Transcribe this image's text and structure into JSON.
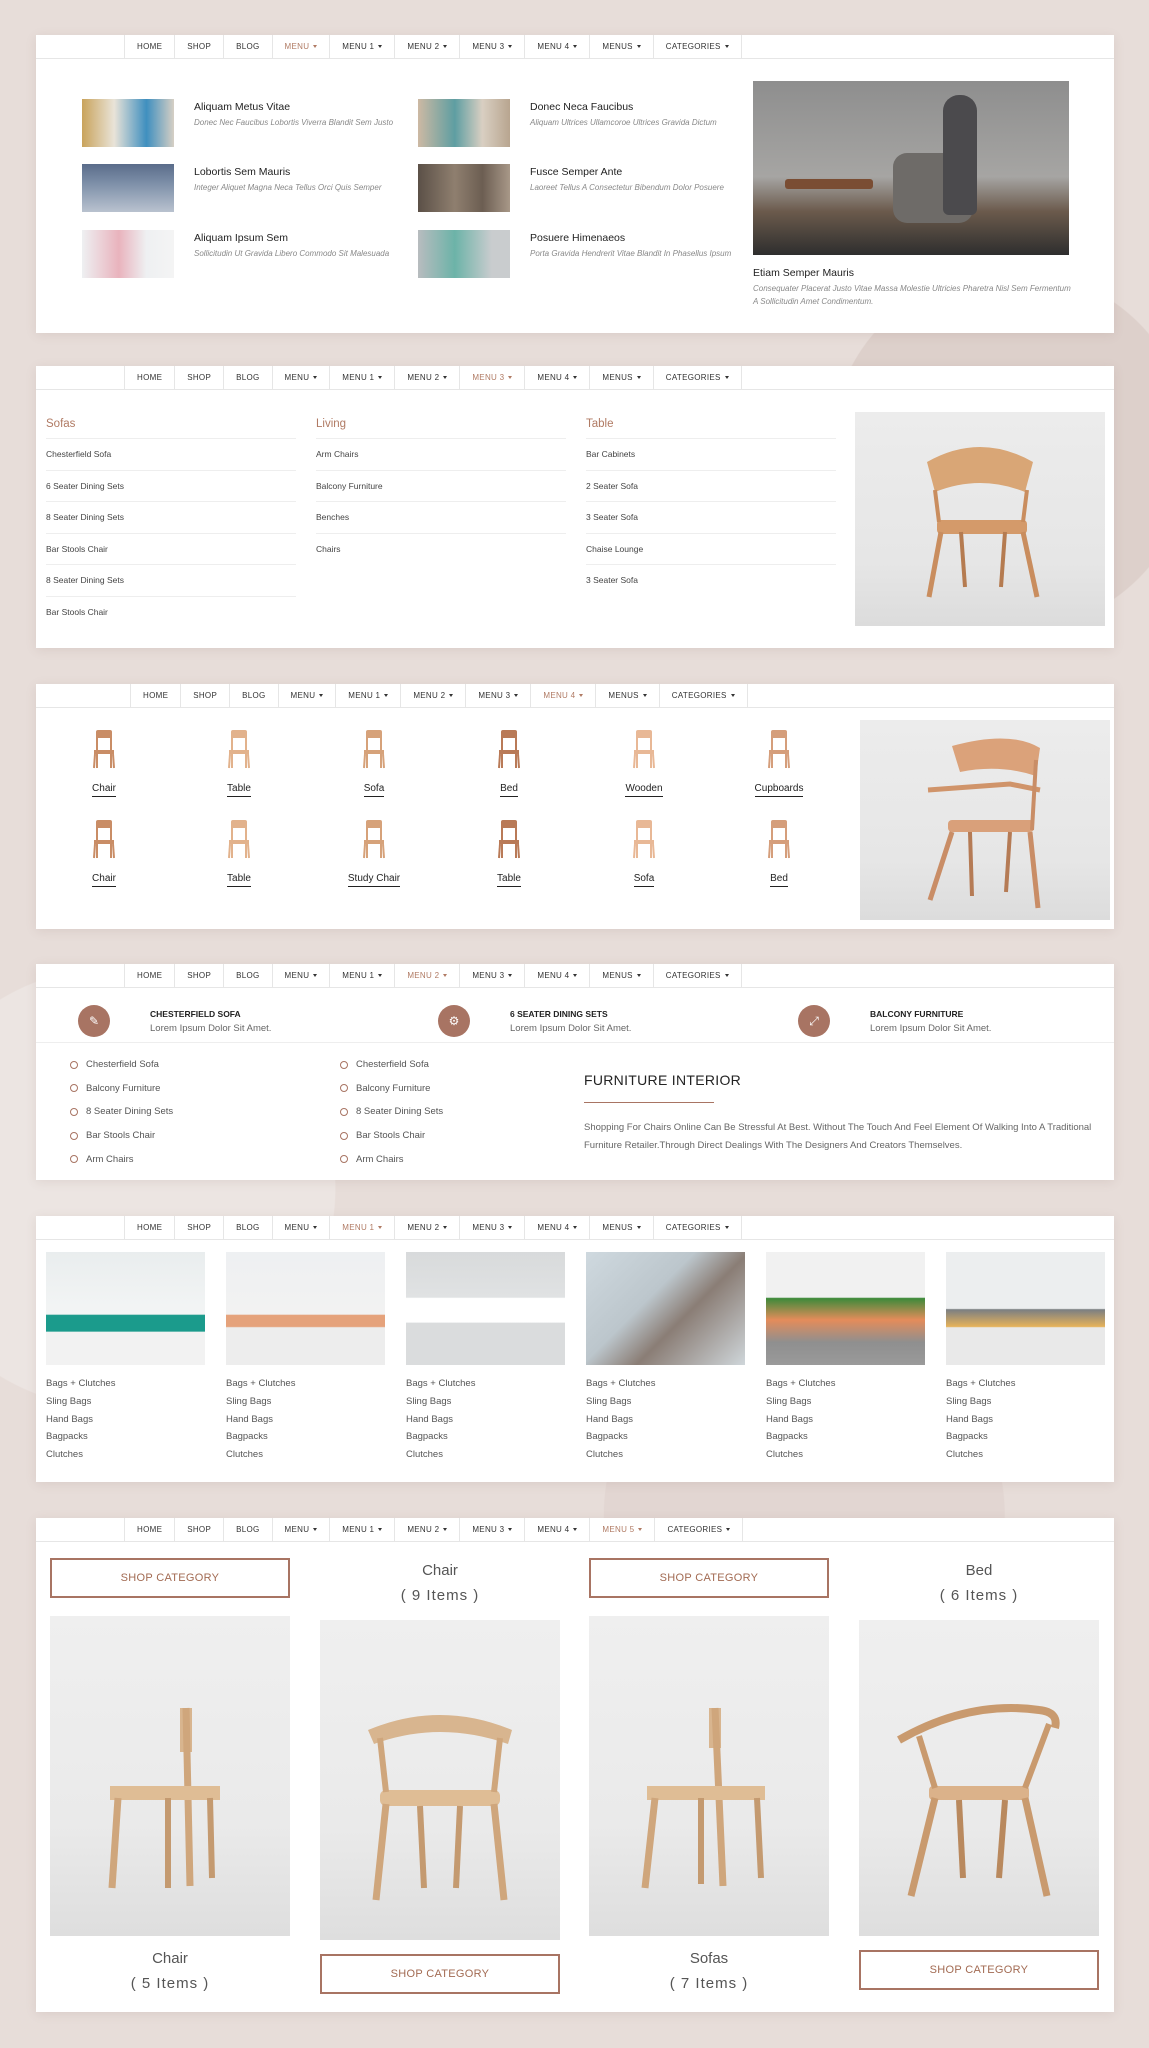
{
  "nav": {
    "items": [
      "HOME",
      "SHOP",
      "BLOG",
      "MENU",
      "MENU 1",
      "MENU 2",
      "MENU 3",
      "MENU 4",
      "MENUS",
      "CATEGORIES"
    ],
    "panel6_items": [
      "HOME",
      "SHOP",
      "BLOG",
      "MENU",
      "MENU 1",
      "MENU 2",
      "MENU 3",
      "MENU 4",
      "MENU 5",
      "CATEGORIES"
    ]
  },
  "accent_color": "#a87463",
  "panel1": {
    "posts": [
      {
        "title": "Aliquam Metus Vitae",
        "desc": "Donec Nec Faucibus Lobortis Viverra Blandit Sem Justo"
      },
      {
        "title": "Lobortis Sem Mauris",
        "desc": "Integer Aliquet Magna Neca Tellus Orci Quis Semper"
      },
      {
        "title": "Aliquam Ipsum Sem",
        "desc": "Sollicitudin Ut Gravida Libero Commodo Sit Malesuada"
      },
      {
        "title": "Donec Neca Faucibus",
        "desc": "Aliquam Ultrices Ullamcoroe Ultrices Gravida Dictum"
      },
      {
        "title": "Fusce Semper Ante",
        "desc": "Laoreet Tellus A Consectetur Bibendum Dolor Posuere"
      },
      {
        "title": "Posuere Himenaeos",
        "desc": "Porta Gravida Hendrerit Vitae Blandit In Phasellus Ipsum"
      }
    ],
    "featured": {
      "title": "Etiam Semper Mauris",
      "desc": "Consequater Placerat Justo Vitae Massa Molestie Ultricies Pharetra Nisl Sem Fermentum A Sollicitudin Amet Condimentum."
    }
  },
  "panel2": {
    "columns": [
      {
        "title": "Sofas",
        "items": [
          "Chesterfield Sofa",
          "6 Seater Dining Sets",
          "8 Seater Dining Sets",
          "Bar Stools Chair",
          "8 Seater Dining Sets",
          "Bar Stools Chair"
        ]
      },
      {
        "title": "Living",
        "items": [
          "Arm Chairs",
          "Balcony Furniture",
          "Benches",
          "Chairs"
        ]
      },
      {
        "title": "Table",
        "items": [
          "Bar Cabinets",
          "2 Seater Sofa",
          "3 Seater Sofa",
          "Chaise Lounge",
          "3 Seater Sofa"
        ]
      }
    ]
  },
  "panel3": {
    "categories": [
      "Chair",
      "Table",
      "Sofa",
      "Bed",
      "Wooden",
      "Cupboards",
      "Chair",
      "Table",
      "Study Chair",
      "Table",
      "Sofa",
      "Bed"
    ]
  },
  "panel4": {
    "features": [
      {
        "title": "CHESTERFIELD SOFA",
        "sub": "Lorem Ipsum Dolor Sit Amet.",
        "icon": "pencil-icon"
      },
      {
        "title": "6 SEATER DINING SETS",
        "sub": "Lorem Ipsum Dolor Sit Amet.",
        "icon": "gear-icon"
      },
      {
        "title": "BALCONY FURNITURE",
        "sub": "Lorem Ipsum Dolor Sit Amet.",
        "icon": "expand-icon"
      }
    ],
    "list1": [
      "Chesterfield Sofa",
      "Balcony Furniture",
      "8 Seater Dining Sets",
      "Bar Stools Chair",
      "Arm Chairs"
    ],
    "list2": [
      "Chesterfield Sofa",
      "Balcony Furniture",
      "8 Seater Dining Sets",
      "Bar Stools Chair",
      "Arm Chairs"
    ],
    "heading": "FURNITURE INTERIOR",
    "text": "Shopping For Chairs Online Can Be Stressful At Best. Without The Touch And Feel Element Of Walking Into A Traditional Furniture Retailer.Through Direct Dealings With The Designers And Creators Themselves."
  },
  "panel5": {
    "lists": [
      "Bags + Clutches",
      "Sling Bags",
      "Hand Bags",
      "Bagpacks",
      "Clutches"
    ]
  },
  "panel6": {
    "shop_label": "SHOP CATEGORY",
    "cards": [
      {
        "name": "Chair",
        "count": "( 5 Items )"
      },
      {
        "name": "Chair",
        "count": "( 9 Items )"
      },
      {
        "name": "Sofas",
        "count": "( 7 Items )"
      },
      {
        "name": "Bed",
        "count": "( 6 Items )"
      }
    ]
  }
}
